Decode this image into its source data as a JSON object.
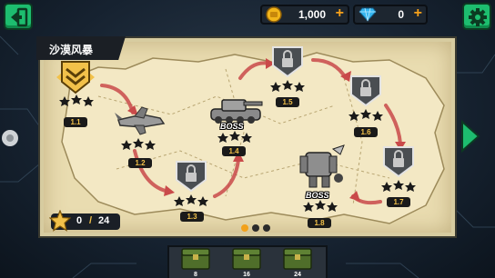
{
  "header": {
    "coins": "1,000",
    "gems": "0",
    "coin_plus": "+",
    "gem_plus": "+"
  },
  "region": {
    "name": "沙漠风暴"
  },
  "stages": [
    {
      "id": "1.1",
      "state": "current",
      "stars": 3
    },
    {
      "id": "1.2",
      "state": "unlocked",
      "stars": 3
    },
    {
      "id": "1.3",
      "state": "locked",
      "stars": 3
    },
    {
      "id": "1.4",
      "state": "boss",
      "stars": 3
    },
    {
      "id": "1.5",
      "state": "locked",
      "stars": 3
    },
    {
      "id": "1.6",
      "state": "locked",
      "stars": 3
    },
    {
      "id": "1.7",
      "state": "locked",
      "stars": 3
    },
    {
      "id": "1.8",
      "state": "boss",
      "stars": 3
    }
  ],
  "boss_label": "BOSS",
  "stars": {
    "current": "0",
    "separator": "/",
    "total": "24"
  },
  "page_dots": {
    "count": 3,
    "active": 0
  },
  "rewards": [
    {
      "stars": "8"
    },
    {
      "stars": "16"
    },
    {
      "stars": "24"
    }
  ],
  "colors": {
    "accent_green": "#1dbd6f",
    "gold": "#f2c14a",
    "path_red": "#c94a4a",
    "parchment": "#e9dcb0"
  },
  "icons": {
    "back": "back-arrow-icon",
    "settings": "gear-icon",
    "coin": "coin-icon",
    "gem": "diamond-icon",
    "next": "chevron-right-icon",
    "chest": "ammo-crate-icon"
  }
}
